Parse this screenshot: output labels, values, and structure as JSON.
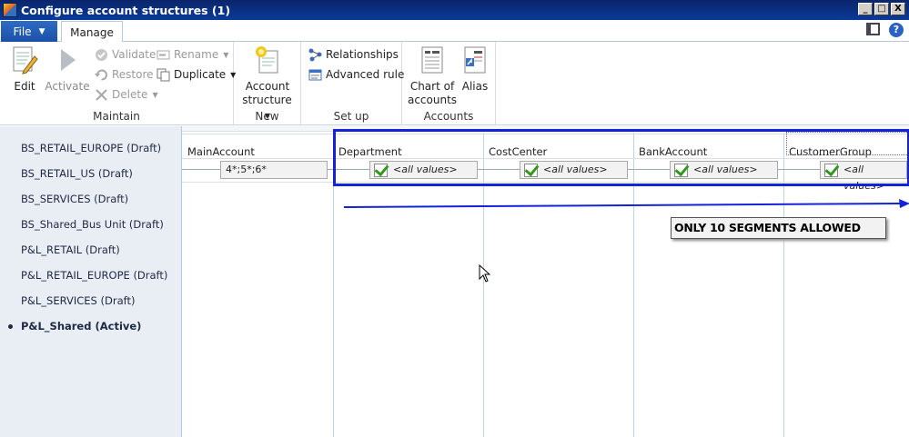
{
  "window": {
    "title": "Configure account structures (1)",
    "controls": [
      "_",
      "□",
      "X"
    ]
  },
  "tabs": {
    "file_label": "File",
    "manage_label": "Manage"
  },
  "ribbon": {
    "maintain": {
      "label": "Maintain",
      "edit": "Edit",
      "activate": "Activate",
      "validate": "Validate",
      "restore": "Restore",
      "delete": "Delete",
      "rename": "Rename",
      "duplicate": "Duplicate"
    },
    "new": {
      "label": "New",
      "account_structure_line1": "Account",
      "account_structure_line2": "structure"
    },
    "setup": {
      "label": "Set up",
      "relationships": "Relationships",
      "advanced_rule": "Advanced rule"
    },
    "accounts": {
      "label": "Accounts",
      "chart_line1": "Chart of",
      "chart_line2": "accounts",
      "alias": "Alias"
    }
  },
  "structures": [
    {
      "label": "BS_RETAIL_EUROPE (Draft)",
      "active": false
    },
    {
      "label": "BS_RETAIL_US (Draft)",
      "active": false
    },
    {
      "label": "BS_SERVICES (Draft)",
      "active": false
    },
    {
      "label": "BS_Shared_Bus Unit (Draft)",
      "active": false
    },
    {
      "label": "P&L_RETAIL (Draft)",
      "active": false
    },
    {
      "label": "P&L_RETAIL_EUROPE (Draft)",
      "active": false
    },
    {
      "label": "P&L_SERVICES (Draft)",
      "active": false
    },
    {
      "label": "P&L_Shared (Active)",
      "active": true
    }
  ],
  "grid": {
    "columns": [
      "MainAccount",
      "Department",
      "CostCenter",
      "BankAccount",
      "CustomerGroup"
    ],
    "main_account_value": "4*;5*;6*",
    "segment_value": "<all values>"
  },
  "annotation": {
    "text": "ONLY 10 SEGMENTS ALLOWED",
    "color": "#1423d8"
  }
}
